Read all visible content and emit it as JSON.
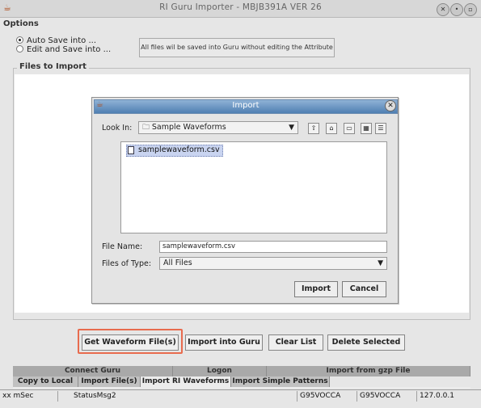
{
  "window": {
    "title": "RI Guru Importer - MBJB391A  VER 26",
    "controls": [
      "close-icon",
      "minimize-icon",
      "maximize-icon"
    ]
  },
  "menu": {
    "options": "Options"
  },
  "save_mode": {
    "auto_save": "Auto Save into ...",
    "edit_save": "Edit and Save into ...",
    "selected": "auto_save",
    "info": "All files wil be saved into Guru without  editing the Attribute"
  },
  "files_group": {
    "label": "Files to Import"
  },
  "dialog": {
    "title": "Import",
    "look_in_label": "Look In:",
    "look_in_value": "Sample Waveforms",
    "files": [
      "samplewaveform.csv"
    ],
    "file_name_label": "File Name:",
    "file_name_value": "samplewaveform.csv",
    "files_of_type_label": "Files of Type:",
    "files_of_type_value": "All Files",
    "import_button": "Import",
    "cancel_button": "Cancel"
  },
  "actions": {
    "get_waveform": "Get Waveform File(s)",
    "import_guru": "Import into Guru",
    "clear_list": "Clear List",
    "delete_selected": "Delete Selected"
  },
  "tabs_row1": [
    "Connect Guru",
    "Logon",
    "Import from gzp File"
  ],
  "tabs_row2": [
    "Copy to Local",
    "Import File(s)",
    "Import RI Waveforms",
    "Import Simple Patterns"
  ],
  "active_tab": "Import RI Waveforms",
  "status": {
    "timing": "xx mSec",
    "message": "StatusMsg2",
    "user1": "G95VOCCA",
    "user2": "G95VOCCA",
    "ip": "127.0.0.1"
  },
  "colors": {
    "highlight": "#e86b4e",
    "dialog_title": "#5b88bb",
    "selected_file": "#c9d4f0"
  }
}
